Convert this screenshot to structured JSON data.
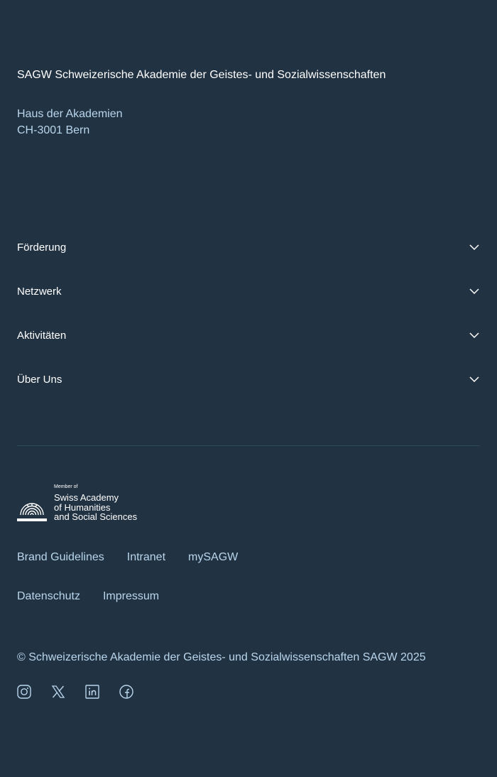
{
  "footer": {
    "org_title": "SAGW Schweizerische Akademie der Geistes- und Sozialwissenschaften",
    "address": {
      "line1": "Haus der Akademien",
      "line2": "CH-3001 Bern"
    },
    "nav": [
      {
        "label": "Förderung",
        "icon": "chevron-down-icon"
      },
      {
        "label": "Netzwerk",
        "icon": "chevron-down-icon"
      },
      {
        "label": "Aktivitäten",
        "icon": "chevron-down-icon"
      },
      {
        "label": "Über Uns",
        "icon": "chevron-down-icon"
      }
    ],
    "member_logo": {
      "caption": "Member of",
      "line1": "Swiss Academy",
      "line2": "of Humanities",
      "line3": "and Social Sciences"
    },
    "links_row1": [
      "Brand Guidelines",
      "Intranet",
      "mySAGW"
    ],
    "links_row2": [
      "Datenschutz",
      "Impressum"
    ],
    "copyright": "© Schweizerische Akademie der Geistes- und Sozialwissenschaften SAGW 2025",
    "social": [
      "instagram-icon",
      "x-icon",
      "linkedin-icon",
      "facebook-icon"
    ]
  },
  "colors": {
    "background": "#213243",
    "text_primary": "#ffffff",
    "text_link": "#b9d6ec",
    "divider": "#2e4b5e"
  }
}
